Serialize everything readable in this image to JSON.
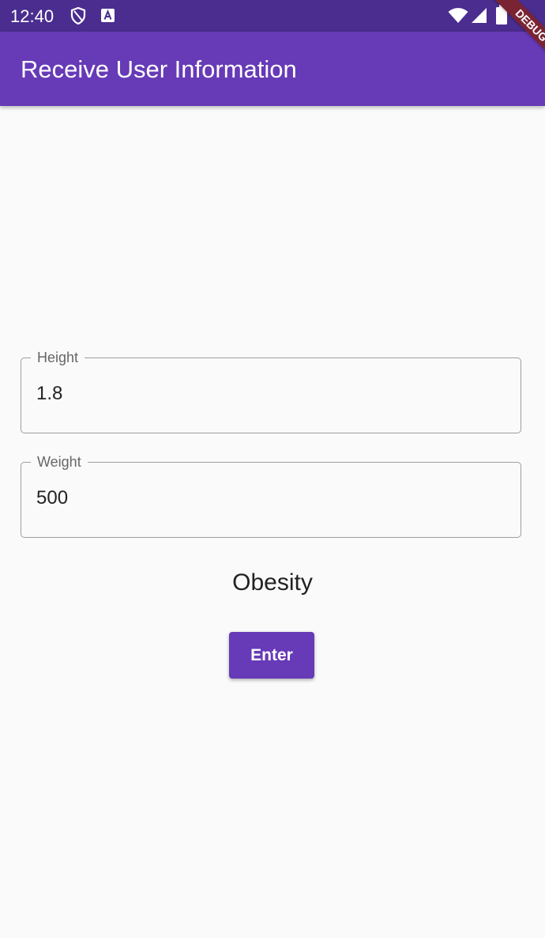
{
  "status_bar": {
    "time": "12:40",
    "icons": [
      "shield-icon",
      "a-badge-icon",
      "wifi-icon",
      "signal-icon",
      "battery-icon"
    ]
  },
  "app_bar": {
    "title": "Receive User Information"
  },
  "debug_banner": {
    "label": "DEBUG"
  },
  "form": {
    "height": {
      "label": "Height",
      "value": "1.8"
    },
    "weight": {
      "label": "Weight",
      "value": "500"
    }
  },
  "result": {
    "text": "Obesity"
  },
  "enter_button": {
    "label": "Enter"
  },
  "colors": {
    "primary": "#673ab7",
    "status_bar": "#4a2d8f",
    "background": "#fafafa",
    "debug_banner": "#7a2433"
  }
}
